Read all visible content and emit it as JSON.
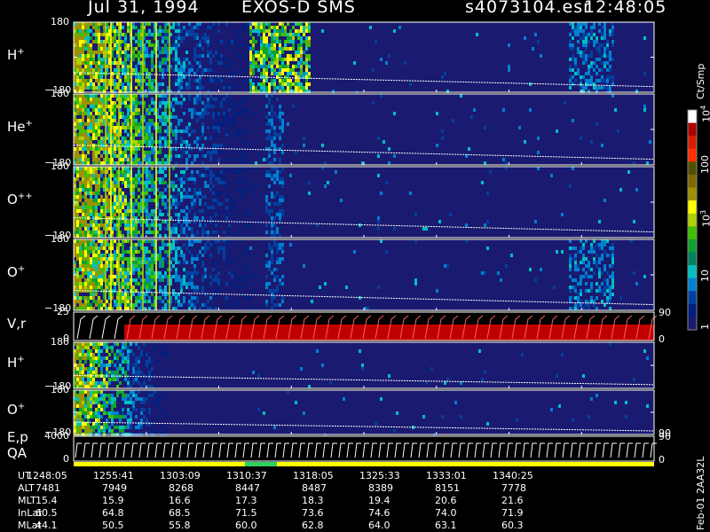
{
  "header": {
    "date": "Jul 31, 1994",
    "instrument": "EXOS-D SMS",
    "file": "s4073104.esr",
    "time": "12:48:05"
  },
  "panels": [
    {
      "id": "h_plus_1",
      "label": "H",
      "sup": "+",
      "ymax": "180",
      "ymin": "−180"
    },
    {
      "id": "he_plus",
      "label": "He",
      "sup": "+",
      "ymax": "180",
      "ymin": "−180"
    },
    {
      "id": "o_plusplus",
      "label": "O",
      "sup": "++",
      "ymax": "180",
      "ymin": "−180"
    },
    {
      "id": "o_plus_1",
      "label": "O",
      "sup": "+",
      "ymax": "180",
      "ymin": "−180"
    },
    {
      "id": "vr",
      "label": "V,r",
      "ymax": "25",
      "ymin": "0",
      "right_top": "90",
      "right_bottom": "0"
    },
    {
      "id": "h_plus_2",
      "label": "H",
      "sup": "+",
      "ymax": "180",
      "ymin": "−180"
    },
    {
      "id": "o_plus_2",
      "label": "O",
      "sup": "+",
      "ymax": "180",
      "ymin": "−180",
      "right_bottom": "90"
    },
    {
      "id": "ep",
      "label": "E,p",
      "label2": "QA",
      "ymax": "4000",
      "ymin": "0",
      "right_top": "90",
      "right_bottom": "0"
    }
  ],
  "colorbar": {
    "title": "Ct/Smp",
    "ticks": [
      "10",
      "100",
      "10",
      "10",
      "1"
    ],
    "tick_sups": [
      "4",
      "",
      "3",
      "",
      ""
    ],
    "tick_values": [
      10000,
      1000,
      100,
      10,
      1
    ],
    "colors": [
      "#ffffff",
      "#b00000",
      "#d82000",
      "#ff3000",
      "#505000",
      "#806800",
      "#a09000",
      "#ffff00",
      "#b0d000",
      "#40c000",
      "#10a030",
      "#008060",
      "#00c0c0",
      "#0080d0",
      "#0040a0",
      "#002080",
      "#1a1a70"
    ]
  },
  "table": {
    "rows": [
      {
        "name": "UT",
        "values": [
          "1248:05",
          "1255:41",
          "1303:09",
          "1310:37",
          "1318:05",
          "1325:33",
          "1333:01",
          "1340:25"
        ]
      },
      {
        "name": "ALT",
        "values": [
          "7481",
          "7949",
          "8268",
          "8447",
          "8487",
          "8389",
          "8151",
          "7778"
        ]
      },
      {
        "name": "MLT",
        "values": [
          "15.4",
          "15.9",
          "16.6",
          "17.3",
          "18.3",
          "19.4",
          "20.6",
          "21.6"
        ]
      },
      {
        "name": "InLat",
        "values": [
          "60.5",
          "64.8",
          "68.5",
          "71.5",
          "73.6",
          "74.6",
          "74.0",
          "71.9"
        ]
      },
      {
        "name": "MLat",
        "values": [
          "44.1",
          "50.5",
          "55.8",
          "60.0",
          "62.8",
          "64.0",
          "63.1",
          "60.3"
        ]
      }
    ]
  },
  "footer_vertical": "Feb-01  2AA32L",
  "chart_data": {
    "type": "heatmap",
    "title": "Jul 31, 1994   EXOS-D SMS",
    "x_ticks": [
      "1248:05",
      "1255:41",
      "1303:09",
      "1310:37",
      "1318:05",
      "1325:33",
      "1333:01",
      "1340:25"
    ],
    "y_range_spectrograms": [
      -180,
      180
    ],
    "colorbar_label": "Ct/Smp",
    "colorbar_range": [
      1,
      10000
    ],
    "colorbar_scale": "log"
  }
}
